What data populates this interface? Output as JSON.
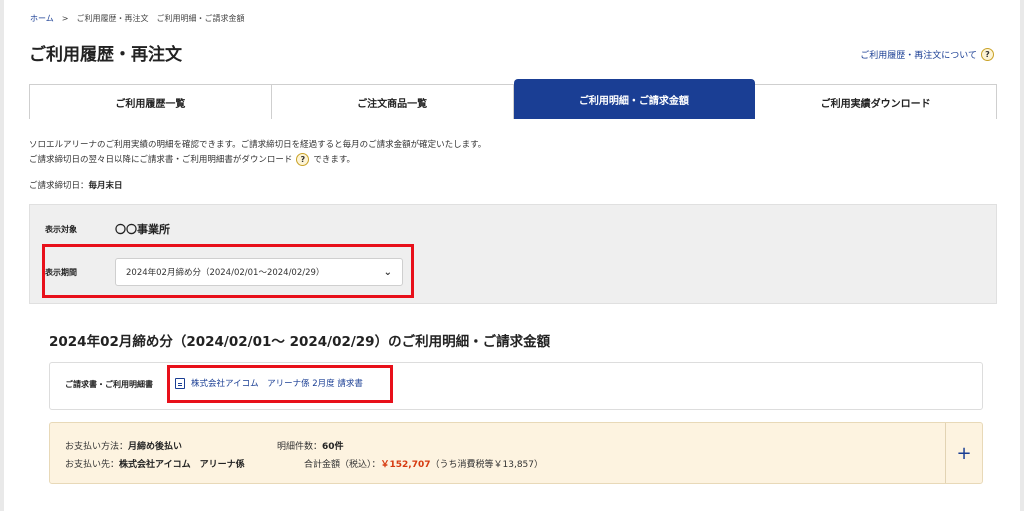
{
  "breadcrumb": {
    "home": "ホーム",
    "separator": ">",
    "current_1": "ご利用履歴・再注文",
    "current_2": "ご利用明細・ご請求金額"
  },
  "page_title": "ご利用履歴・再注文",
  "help_link": "ご利用履歴・再注文について",
  "help_icon": "?",
  "tabs": [
    {
      "label": "ご利用履歴一覧"
    },
    {
      "label": "ご注文商品一覧"
    },
    {
      "label": "ご利用明細・ご請求金額"
    },
    {
      "label": "ご利用実績ダウンロード"
    }
  ],
  "description": {
    "line1": "ソロエルアリーナのご利用実績の明細を確認できます。ご請求締切日を経過すると毎月のご請求金額が確定いたします。",
    "line2_a": "ご請求締切日の翌々日以降にご請求書・ご利用明細書がダウンロード",
    "line2_b": "できます。"
  },
  "cutoff": {
    "label": "ご請求締切日：",
    "value": "毎月末日"
  },
  "filter": {
    "target_label": "表示対象",
    "target_value": "〇〇事業所",
    "period_label": "表示期間",
    "period_value": "2024年02月締め分（2024/02/01～2024/02/29）"
  },
  "section_title": "2024年02月締め分（2024/02/01～ 2024/02/29）のご利用明細・ご請求金額",
  "documents": {
    "label": "ご請求書・ご利用明細書",
    "link": "株式会社アイコム　アリーナ係 2月度 請求書"
  },
  "payment": {
    "method_label": "お支払い方法：",
    "method_value": "月締め後払い",
    "count_label": "明細件数：",
    "count_value": "60件",
    "payee_label": "お支払い先：",
    "payee_value": "株式会社アイコム　アリーナ係",
    "total_label": "合計金額（税込）：",
    "total_value": "￥152,707",
    "tax_note": "（うち消費税等￥13,857）"
  },
  "colors": {
    "brand": "#1a3e94",
    "highlight": "#e8101a",
    "amount": "#d63a10"
  }
}
